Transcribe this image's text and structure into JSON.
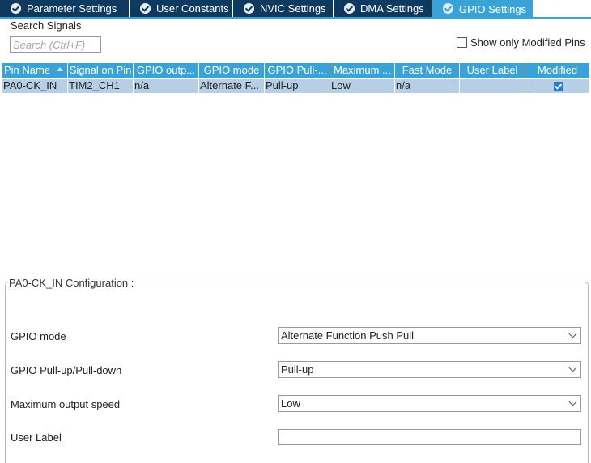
{
  "tabs": [
    {
      "label": "Parameter Settings",
      "active": false
    },
    {
      "label": "User Constants",
      "active": false
    },
    {
      "label": "NVIC Settings",
      "active": false
    },
    {
      "label": "DMA Settings",
      "active": false
    },
    {
      "label": "GPIO Settings",
      "active": true
    }
  ],
  "search": {
    "label": "Search Signals",
    "placeholder": "Search (Ctrl+F)",
    "value": ""
  },
  "filter": {
    "show_only_modified_label": "Show only Modified Pins",
    "checked": false
  },
  "table": {
    "columns": [
      "Pin Name",
      "Signal on Pin",
      "GPIO outp...",
      "GPIO mode",
      "GPIO Pull-...",
      "Maximum ...",
      "Fast Mode",
      "User Label",
      "Modified"
    ],
    "sorted_column": "Pin Name",
    "rows": [
      {
        "pin_name": "PA0-CK_IN",
        "signal": "TIM2_CH1",
        "gpio_output": "n/a",
        "gpio_mode": "Alternate F...",
        "gpio_pull": "Pull-up",
        "max_speed": "Low",
        "fast_mode": "n/a",
        "user_label": "",
        "modified": true,
        "selected": true
      }
    ]
  },
  "config": {
    "title": "PA0-CK_IN Configuration :",
    "gpio_mode": {
      "label": "GPIO mode",
      "value": "Alternate Function Push Pull"
    },
    "gpio_pull": {
      "label": "GPIO Pull-up/Pull-down",
      "value": "Pull-up"
    },
    "max_speed": {
      "label": "Maximum output speed",
      "value": "Low"
    },
    "user_label": {
      "label": "User Label",
      "value": ""
    }
  },
  "colors": {
    "tab_inactive": "#0f3a60",
    "tab_active": "#39a3d7",
    "header_bg": "#39a3d7",
    "row_selected": "#b7cfe6",
    "check_blue": "#1e7fd0"
  }
}
